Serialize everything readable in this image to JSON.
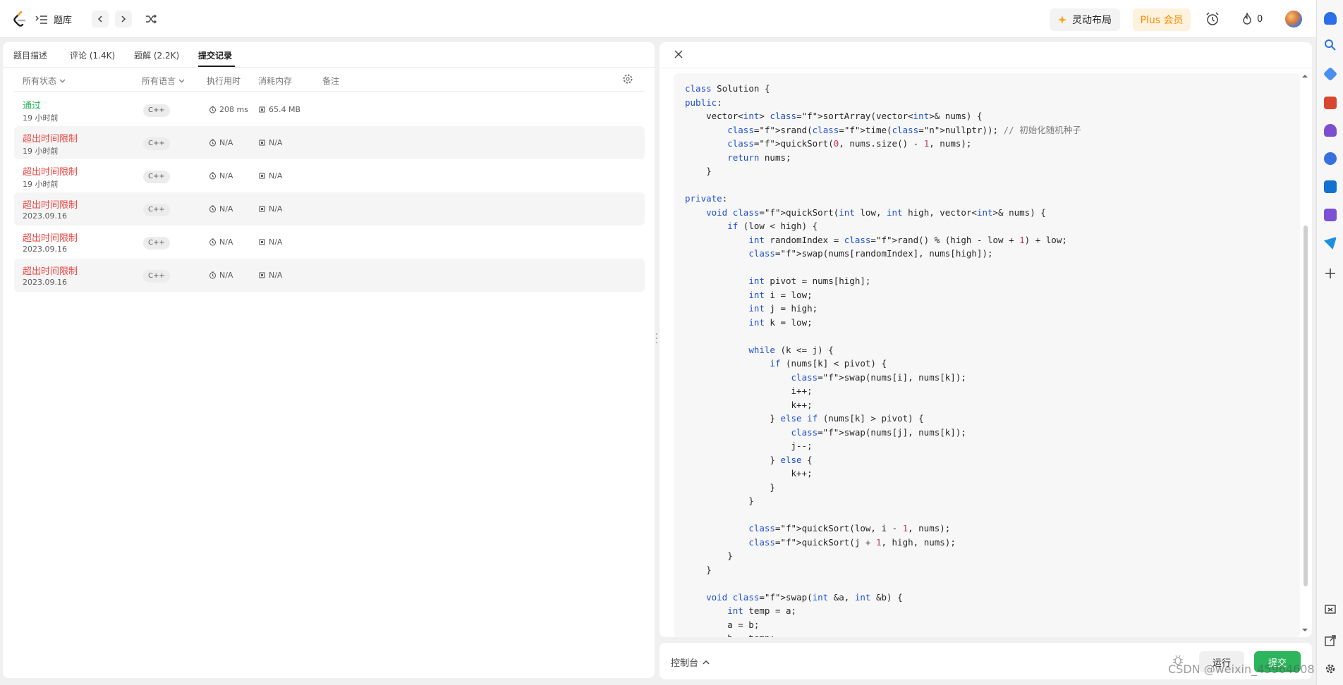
{
  "topbar": {
    "nav_label": "题库",
    "layout_label": "灵动布局",
    "plus_label": "Plus 会员",
    "streak_count": "0"
  },
  "tabs": [
    {
      "label": "题目描述"
    },
    {
      "label": "评论 (1.4K)"
    },
    {
      "label": "题解 (2.2K)"
    },
    {
      "label": "提交记录"
    }
  ],
  "columns": {
    "status": "所有状态",
    "language": "所有语言",
    "runtime": "执行用时",
    "memory": "消耗内存",
    "notes": "备注"
  },
  "submissions": [
    {
      "status": "通过",
      "time": "19 小时前",
      "lang": "C++",
      "runtime": "208 ms",
      "memory": "65.4 MB"
    },
    {
      "status": "超出时间限制",
      "time": "19 小时前",
      "lang": "C++",
      "runtime": "N/A",
      "memory": "N/A"
    },
    {
      "status": "超出时间限制",
      "time": "19 小时前",
      "lang": "C++",
      "runtime": "N/A",
      "memory": "N/A"
    },
    {
      "status": "超出时间限制",
      "time": "2023.09.16",
      "lang": "C++",
      "runtime": "N/A",
      "memory": "N/A"
    },
    {
      "status": "超出时间限制",
      "time": "2023.09.16",
      "lang": "C++",
      "runtime": "N/A",
      "memory": "N/A"
    },
    {
      "status": "超出时间限制",
      "time": "2023.09.16",
      "lang": "C++",
      "runtime": "N/A",
      "memory": "N/A"
    }
  ],
  "code_lines": [
    "class Solution {",
    "public:",
    "    vector<int> sortArray(vector<int>& nums) {",
    "        srand(time(nullptr)); // 初始化随机种子",
    "        quickSort(0, nums.size() - 1, nums);",
    "        return nums;",
    "    }",
    "",
    "private:",
    "    void quickSort(int low, int high, vector<int>& nums) {",
    "        if (low < high) {",
    "            int randomIndex = rand() % (high - low + 1) + low;",
    "            swap(nums[randomIndex], nums[high]);",
    "",
    "            int pivot = nums[high];",
    "            int i = low;",
    "            int j = high;",
    "            int k = low;",
    "",
    "            while (k <= j) {",
    "                if (nums[k] < pivot) {",
    "                    swap(nums[i], nums[k]);",
    "                    i++;",
    "                    k++;",
    "                } else if (nums[k] > pivot) {",
    "                    swap(nums[j], nums[k]);",
    "                    j--;",
    "                } else {",
    "                    k++;",
    "                }",
    "            }",
    "",
    "            quickSort(low, i - 1, nums);",
    "            quickSort(j + 1, high, nums);",
    "        }",
    "    }",
    "",
    "    void swap(int &a, int &b) {",
    "        int temp = a;",
    "        a = b;",
    "        b = temp;"
  ],
  "console": {
    "label": "控制台",
    "run_label": "运行",
    "submit_label": "提交"
  },
  "watermark": "CSDN @weixin_45964608",
  "colors": {
    "accepted": "#2db55d",
    "rejected": "#ef4743",
    "submit_bg": "#2db55d",
    "plus_text": "#ff8a00"
  }
}
